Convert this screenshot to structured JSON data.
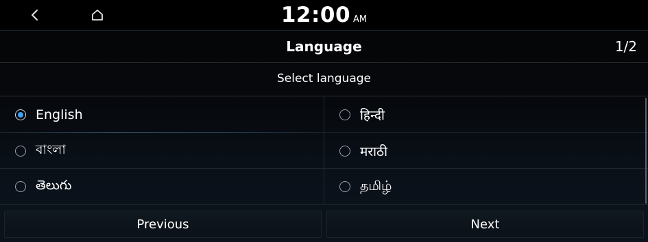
{
  "status_bar": {
    "back_icon": "chevron-left-icon",
    "home_icon": "home-icon",
    "time": "12:00",
    "ampm": "AM"
  },
  "header": {
    "title": "Language",
    "page_indicator": "1/2"
  },
  "subtitle": "Select language",
  "languages": [
    {
      "label": "English",
      "selected": true
    },
    {
      "label": "हिन्दी",
      "selected": false
    },
    {
      "label": "বাংলা",
      "selected": false
    },
    {
      "label": "मराठी",
      "selected": false
    },
    {
      "label": "తెలుగు",
      "selected": false
    },
    {
      "label": "தமிழ்",
      "selected": false
    }
  ],
  "footer": {
    "previous_label": "Previous",
    "next_label": "Next"
  },
  "colors": {
    "accent": "#3aa3ff",
    "background": "#000000"
  }
}
